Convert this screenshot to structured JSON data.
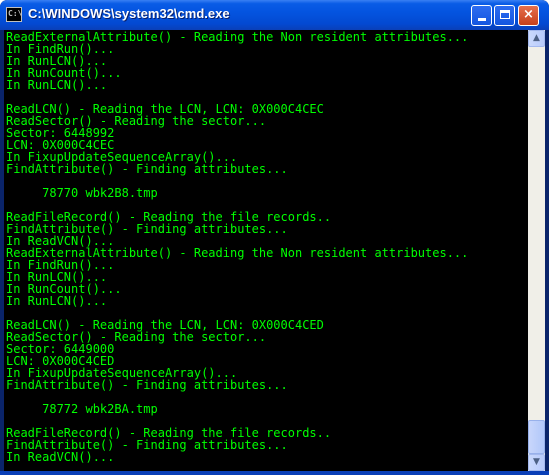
{
  "window": {
    "title": "C:\\WINDOWS\\system32\\cmd.exe",
    "icon_label": "C:\\",
    "minimize_glyph": "",
    "maximize_glyph": "",
    "close_glyph": "×"
  },
  "colors": {
    "console_text": "#00ff00",
    "console_background": "#000000",
    "titlebar": "#0454e0"
  },
  "console": {
    "lines": [
      "ReadExternalAttribute() - Reading the Non resident attributes...",
      "In FindRun()...",
      "In RunLCN()...",
      "In RunCount()...",
      "In RunLCN()...",
      "",
      "ReadLCN() - Reading the LCN, LCN: 0X000C4CEC",
      "ReadSector() - Reading the sector...",
      "Sector: 6448992",
      "LCN: 0X000C4CEC",
      "In FixupUpdateSequenceArray()...",
      "FindAttribute() - Finding attributes...",
      "",
      "     78770 wbk2B8.tmp",
      "",
      "ReadFileRecord() - Reading the file records..",
      "FindAttribute() - Finding attributes...",
      "In ReadVCN()...",
      "ReadExternalAttribute() - Reading the Non resident attributes...",
      "In FindRun()...",
      "In RunLCN()...",
      "In RunCount()...",
      "In RunLCN()...",
      "",
      "ReadLCN() - Reading the LCN, LCN: 0X000C4CED",
      "ReadSector() - Reading the sector...",
      "Sector: 6449000",
      "LCN: 0X000C4CED",
      "In FixupUpdateSequenceArray()...",
      "FindAttribute() - Finding attributes...",
      "",
      "     78772 wbk2BA.tmp",
      "",
      "ReadFileRecord() - Reading the file records..",
      "FindAttribute() - Finding attributes...",
      "In ReadVCN()..."
    ]
  },
  "scrollbar": {
    "up_glyph": "▲",
    "down_glyph": "▼"
  }
}
